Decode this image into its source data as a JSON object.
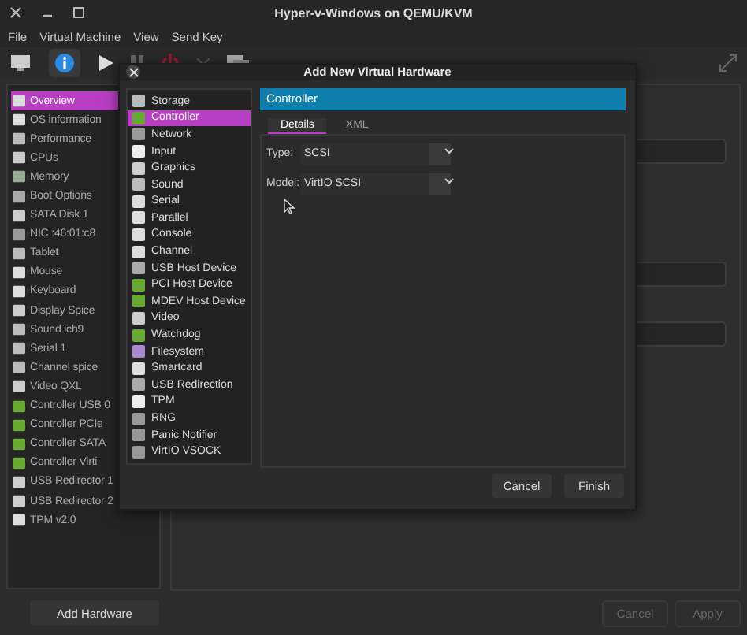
{
  "window": {
    "title": "Hyper-v-Windows on QEMU/KVM"
  },
  "menu": [
    "File",
    "Virtual Machine",
    "View",
    "Send Key"
  ],
  "sidebar": {
    "items": [
      {
        "label": "Overview",
        "selected": true
      },
      {
        "label": "OS information",
        "selected": false
      },
      {
        "label": "Performance",
        "selected": false
      },
      {
        "label": "CPUs",
        "selected": false
      },
      {
        "label": "Memory",
        "selected": false
      },
      {
        "label": "Boot Options",
        "selected": false
      },
      {
        "label": "SATA Disk 1",
        "selected": false
      },
      {
        "label": "NIC :46:01:c8",
        "selected": false
      },
      {
        "label": "Tablet",
        "selected": false
      },
      {
        "label": "Mouse",
        "selected": false
      },
      {
        "label": "Keyboard",
        "selected": false
      },
      {
        "label": "Display Spice",
        "selected": false
      },
      {
        "label": "Sound ich9",
        "selected": false
      },
      {
        "label": "Serial 1",
        "selected": false
      },
      {
        "label": "Channel spice",
        "selected": false
      },
      {
        "label": "Video QXL",
        "selected": false
      },
      {
        "label": "Controller USB 0",
        "selected": false
      },
      {
        "label": "Controller PCIe",
        "selected": false
      },
      {
        "label": "Controller SATA",
        "selected": false
      },
      {
        "label": "Controller Virti",
        "selected": false
      },
      {
        "label": "USB Redirector 1",
        "selected": false
      },
      {
        "label": "USB Redirector 2",
        "selected": false
      },
      {
        "label": "TPM v2.0",
        "selected": false
      }
    ]
  },
  "add_hardware_button": "Add Hardware",
  "footer_buttons": [
    {
      "label": "Cancel",
      "disabled": true
    },
    {
      "label": "Apply",
      "disabled": true
    }
  ],
  "dialog": {
    "title": "Add New Virtual Hardware",
    "device_types": [
      {
        "label": "Storage",
        "selected": false
      },
      {
        "label": "Controller",
        "selected": true
      },
      {
        "label": "Network",
        "selected": false
      },
      {
        "label": "Input",
        "selected": false
      },
      {
        "label": "Graphics",
        "selected": false
      },
      {
        "label": "Sound",
        "selected": false
      },
      {
        "label": "Serial",
        "selected": false
      },
      {
        "label": "Parallel",
        "selected": false
      },
      {
        "label": "Console",
        "selected": false
      },
      {
        "label": "Channel",
        "selected": false
      },
      {
        "label": "USB Host Device",
        "selected": false
      },
      {
        "label": "PCI Host Device",
        "selected": false
      },
      {
        "label": "MDEV Host Device",
        "selected": false
      },
      {
        "label": "Video",
        "selected": false
      },
      {
        "label": "Watchdog",
        "selected": false
      },
      {
        "label": "Filesystem",
        "selected": false
      },
      {
        "label": "Smartcard",
        "selected": false
      },
      {
        "label": "USB Redirection",
        "selected": false
      },
      {
        "label": "TPM",
        "selected": false
      },
      {
        "label": "RNG",
        "selected": false
      },
      {
        "label": "Panic Notifier",
        "selected": false
      },
      {
        "label": "VirtIO VSOCK",
        "selected": false
      }
    ],
    "header": "Controller",
    "tabs": [
      {
        "label": "Details",
        "selected": true
      },
      {
        "label": "XML",
        "selected": false
      }
    ],
    "fields": [
      {
        "label": "Type:",
        "value": "SCSI"
      },
      {
        "label": "Model:",
        "value": "VirtIO SCSI"
      }
    ],
    "buttons": [
      "Cancel",
      "Finish"
    ]
  }
}
